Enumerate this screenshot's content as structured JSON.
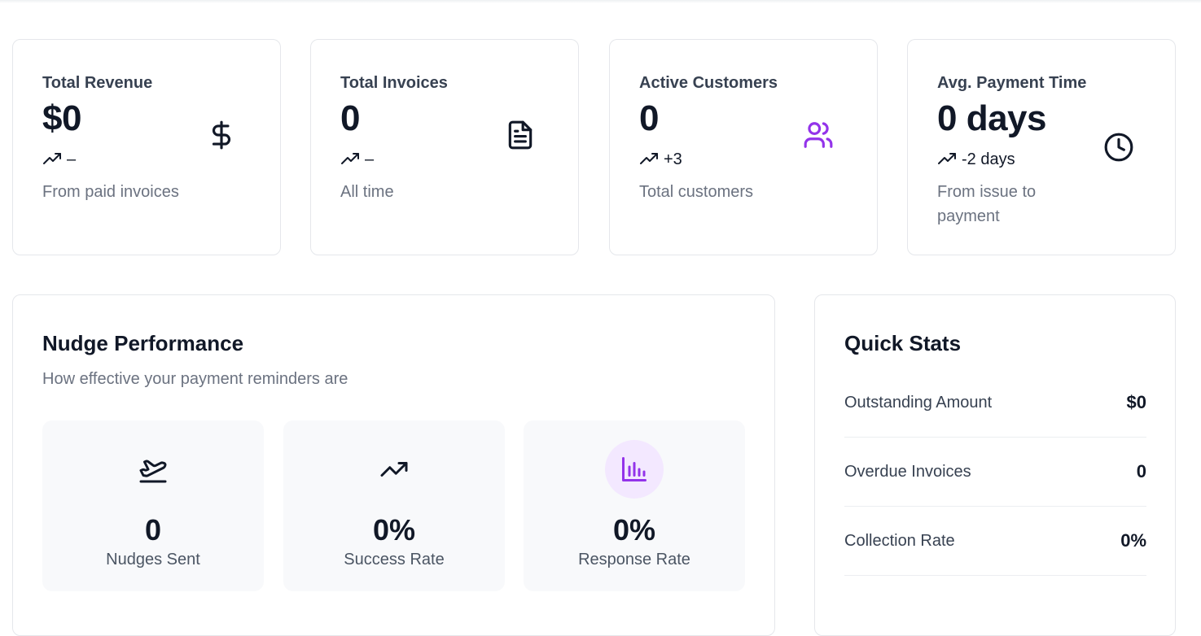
{
  "colors": {
    "accent": "#9333ea",
    "accent_bg": "#f3e8ff",
    "card_border": "#e5e7eb",
    "muted_text": "#6b7280"
  },
  "stats": [
    {
      "title": "Total Revenue",
      "value": "$0",
      "trend": "–",
      "subtitle": "From paid invoices",
      "icon": "dollar-sign-icon"
    },
    {
      "title": "Total Invoices",
      "value": "0",
      "trend": "–",
      "subtitle": "All time",
      "icon": "file-text-icon"
    },
    {
      "title": "Active Customers",
      "value": "0",
      "trend": "+3",
      "subtitle": "Total customers",
      "icon": "users-icon"
    },
    {
      "title": "Avg. Payment Time",
      "value": "0 days",
      "trend": "-2 days",
      "subtitle": "From issue to payment",
      "icon": "clock-icon"
    }
  ],
  "nudge": {
    "title": "Nudge Performance",
    "subtitle": "How effective your payment reminders are",
    "metrics": [
      {
        "value": "0",
        "label": "Nudges Sent",
        "icon": "plane-takeoff-icon"
      },
      {
        "value": "0%",
        "label": "Success Rate",
        "icon": "trending-up-icon"
      },
      {
        "value": "0%",
        "label": "Response Rate",
        "icon": "bar-chart-icon"
      }
    ]
  },
  "quick_stats": {
    "title": "Quick Stats",
    "rows": [
      {
        "label": "Outstanding Amount",
        "value": "$0"
      },
      {
        "label": "Overdue Invoices",
        "value": "0"
      },
      {
        "label": "Collection Rate",
        "value": "0%"
      }
    ]
  }
}
